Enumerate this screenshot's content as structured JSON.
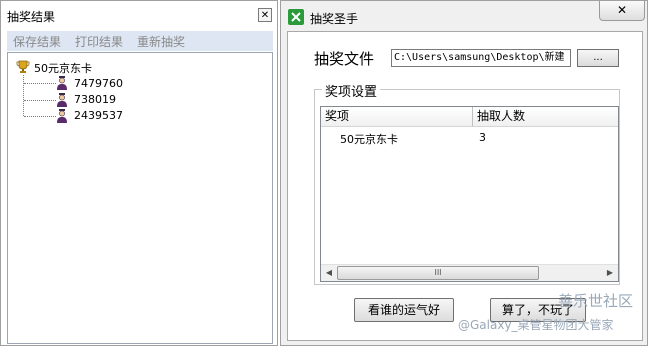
{
  "left_window": {
    "title": "抽奖结果",
    "close_label": "☒",
    "menu": [
      "保存结果",
      "打印结果",
      "重新抽奖"
    ],
    "tree": {
      "root_label": "50元京东卡",
      "children": [
        "7479760",
        "738019",
        "2439537"
      ]
    }
  },
  "right_window": {
    "title": "抽奖圣手",
    "close_label": "✕",
    "file_label": "抽奖文件",
    "file_value": "C:\\Users\\samsung\\Desktop\\新建",
    "browse_label": "...",
    "group_title": "奖项设置",
    "columns": [
      "奖项",
      "抽取人数"
    ],
    "rows": [
      {
        "prize": "50元京东卡",
        "count": "3"
      }
    ],
    "scroll_left_arrow": "◀",
    "scroll_right_arrow": "▶",
    "scroll_grip": "III",
    "draw_button": "看谁的运气好",
    "quit_button": "算了，不玩了"
  },
  "watermark": {
    "line1": "善乐世社区",
    "line2": "@Galaxy_桌管星物团大管家"
  },
  "colors": {
    "menubar": "#dde6f2",
    "app_icon_green": "#2a9a3a"
  }
}
